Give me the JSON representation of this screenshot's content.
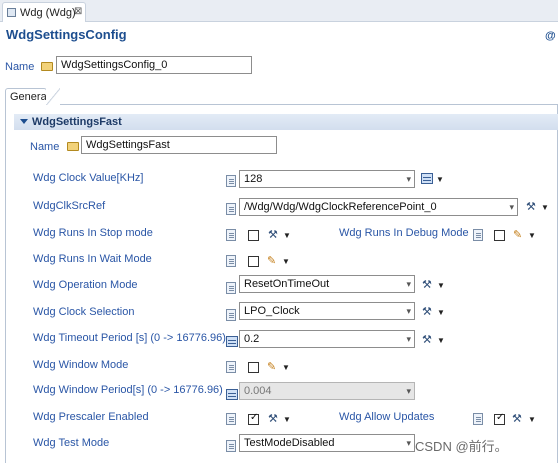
{
  "editor_tab": {
    "label": "Wdg (Wdg)",
    "close": "⊠"
  },
  "header": {
    "title": "WdgSettingsConfig",
    "corner": "@"
  },
  "name_row": {
    "label": "Name",
    "value": "WdgSettingsConfig_0"
  },
  "general_tab": {
    "label": "General"
  },
  "section": {
    "title": "WdgSettingsFast"
  },
  "section_name": {
    "label": "Name",
    "value": "WdgSettingsFast"
  },
  "fields": {
    "clock_value": {
      "label": "Wdg Clock Value[KHz]",
      "value": "128"
    },
    "clk_src_ref": {
      "label": "WdgClkSrcRef",
      "value": "/Wdg/Wdg/WdgClockReferencePoint_0"
    },
    "runs_stop": {
      "label": "Wdg Runs In Stop mode"
    },
    "runs_debug": {
      "label": "Wdg Runs In Debug Mode"
    },
    "runs_wait": {
      "label": "Wdg Runs In Wait Mode"
    },
    "operation_mode": {
      "label": "Wdg Operation Mode",
      "value": "ResetOnTimeOut"
    },
    "clock_selection": {
      "label": "Wdg Clock Selection",
      "value": "LPO_Clock"
    },
    "timeout_period": {
      "label": "Wdg Timeout Period [s] (0 -> 16776.96)",
      "value": "0.2"
    },
    "window_mode": {
      "label": "Wdg Window Mode"
    },
    "window_period": {
      "label": "Wdg Window Period[s] (0 -> 16776.96)",
      "value": "0.004"
    },
    "prescaler": {
      "label": "Wdg Prescaler Enabled"
    },
    "allow_updates": {
      "label": "Wdg Allow Updates"
    },
    "test_mode": {
      "label": "Wdg Test Mode",
      "value": "TestModeDisabled"
    }
  },
  "watermark": "CSDN @前行。",
  "colors": {
    "label_blue": "#2a56a6",
    "title_blue": "#1d4e8f",
    "section_bg": "#d8e2f0"
  },
  "icons": {
    "folder": "folder-icon",
    "field": "field-type-icon",
    "pen": "pencil-icon",
    "tool": "wrench-icon",
    "calc": "calculator-icon"
  }
}
